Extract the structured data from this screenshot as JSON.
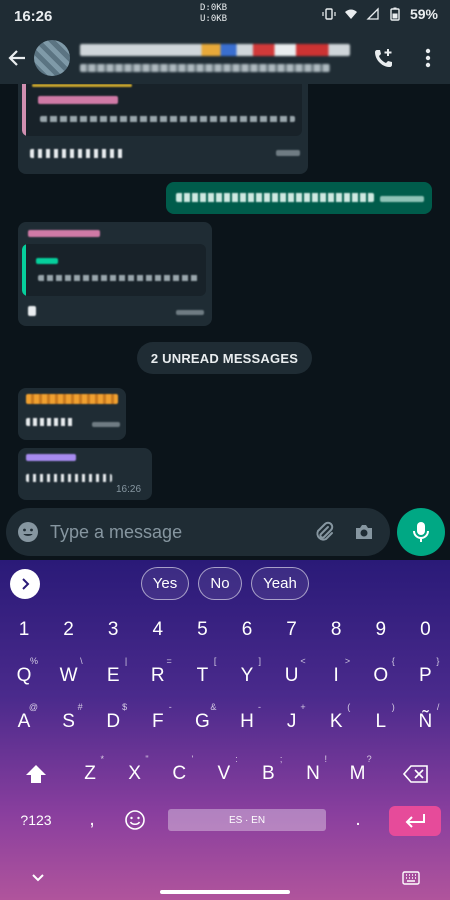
{
  "status_bar": {
    "time": "16:26",
    "net_down": "D:0KB",
    "net_up": "U:0KB",
    "battery": "59%"
  },
  "chat": {
    "times": [
      "16:2"
    ],
    "unread_label": "2 UNREAD MESSAGES",
    "last_time": "16:26"
  },
  "composer": {
    "placeholder": "Type a message"
  },
  "keyboard": {
    "suggestions": [
      "Yes",
      "No",
      "Yeah"
    ],
    "number_row": [
      "1",
      "2",
      "3",
      "4",
      "5",
      "6",
      "7",
      "8",
      "9",
      "0"
    ],
    "row1": [
      {
        "k": "Q",
        "s": "%"
      },
      {
        "k": "W",
        "s": "\\"
      },
      {
        "k": "E",
        "s": "|"
      },
      {
        "k": "R",
        "s": "="
      },
      {
        "k": "T",
        "s": "["
      },
      {
        "k": "Y",
        "s": "]"
      },
      {
        "k": "U",
        "s": "<"
      },
      {
        "k": "I",
        "s": ">"
      },
      {
        "k": "O",
        "s": "{"
      },
      {
        "k": "P",
        "s": "}"
      }
    ],
    "row2": [
      {
        "k": "A",
        "s": "@"
      },
      {
        "k": "S",
        "s": "#"
      },
      {
        "k": "D",
        "s": "$"
      },
      {
        "k": "F",
        "s": "-"
      },
      {
        "k": "G",
        "s": "&"
      },
      {
        "k": "H",
        "s": "-"
      },
      {
        "k": "J",
        "s": "+"
      },
      {
        "k": "K",
        "s": "("
      },
      {
        "k": "L",
        "s": ")"
      },
      {
        "k": "Ñ",
        "s": "/"
      }
    ],
    "row3": [
      {
        "k": "Z",
        "s": "*"
      },
      {
        "k": "X",
        "s": "\""
      },
      {
        "k": "C",
        "s": "'"
      },
      {
        "k": "V",
        "s": ":"
      },
      {
        "k": "B",
        "s": ";"
      },
      {
        "k": "N",
        "s": "!"
      },
      {
        "k": "M",
        "s": "?"
      }
    ],
    "symbols_label": "?123",
    "comma": ",",
    "period": ".",
    "space_label": "ES · EN"
  },
  "colors": {
    "accent_green": "#00a884",
    "outgoing_bubble": "#005c4b",
    "enter_key": "#e64b9a"
  },
  "icons": [
    "back-arrow-icon",
    "add-call-icon",
    "more-vert-icon",
    "emoji-icon",
    "attach-icon",
    "camera-icon",
    "mic-icon",
    "chevron-right-icon",
    "shift-icon",
    "backspace-icon",
    "enter-icon",
    "hide-keyboard-icon",
    "keyboard-switch-icon"
  ]
}
